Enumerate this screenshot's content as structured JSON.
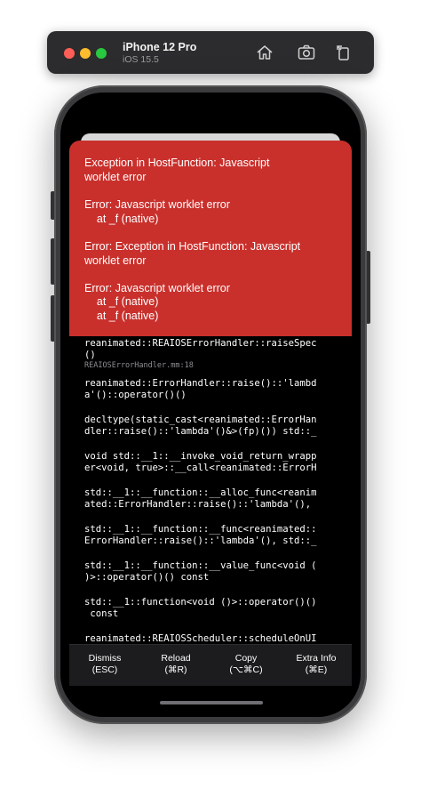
{
  "simulator": {
    "device_name": "iPhone 12 Pro",
    "os_version": "iOS 15.5",
    "toolbar_icons": [
      "home-icon",
      "screenshot-icon",
      "rotate-icon"
    ],
    "traffic_light_colors": [
      "#ff5f57",
      "#febc2e",
      "#28c840"
    ]
  },
  "error": {
    "background": "#c9302c",
    "lines": [
      "Exception in HostFunction: Javascript",
      "worklet error",
      "Error: Javascript worklet error",
      "    at _f (native)",
      "Error: Exception in HostFunction: Javascript",
      "worklet error",
      "Error: Javascript worklet error",
      "    at _f (native)",
      "    at _f (native)"
    ]
  },
  "stack": {
    "frames": [
      "reanimated::REAIOSErrorHandler::raiseSpec",
      "()",
      "reanimated::ErrorHandler::raise()::'lambd",
      "a'()::operator()()",
      "decltype(static_cast<reanimated::ErrorHan",
      "dler::raise()::'lambda'()&>(fp)()) std::_",
      "void std::__1::__invoke_void_return_wrapp",
      "er<void, true>::__call<reanimated::ErrorH",
      "std::__1::__function::__alloc_func<reanim",
      "ated::ErrorHandler::raise()::'lambda'(),",
      "std::__1::__function::__func<reanimated::",
      "ErrorHandler::raise()::'lambda'(), std::_",
      "std::__1::__function::__value_func<void (",
      ")>::operator()() const",
      "std::__1::function<void ()>::operator()()",
      " const",
      "reanimated::REAIOSScheduler::scheduleOnUI"
    ],
    "file_ref": "REAIOSErrorHandler.mm:18"
  },
  "footer": {
    "buttons": [
      {
        "label": "Dismiss",
        "shortcut": "(ESC)"
      },
      {
        "label": "Reload",
        "shortcut": "(⌘R)"
      },
      {
        "label": "Copy",
        "shortcut": "(⌥⌘C)"
      },
      {
        "label": "Extra Info",
        "shortcut": "(⌘E)"
      }
    ]
  }
}
